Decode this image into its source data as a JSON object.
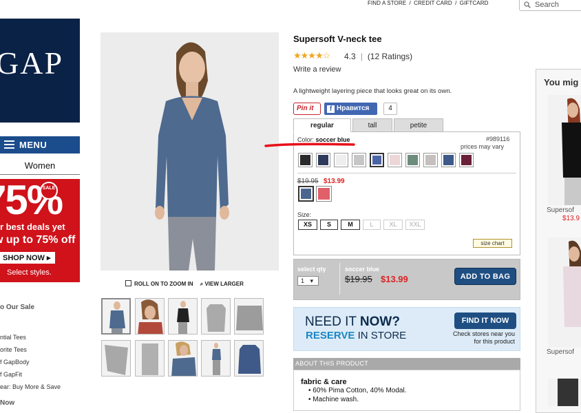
{
  "utility": {
    "find_store": "FIND A STORE",
    "credit_card": "CREDIT CARD",
    "giftcard": "GIFTCARD",
    "sep": "/",
    "search_placeholder": "Search"
  },
  "sidebar": {
    "logo": "GAP",
    "menu_label": "MENU",
    "department": "Women",
    "promo": {
      "big": "75%",
      "sale_badge": "SALE",
      "line1": "ur best deals yet",
      "line2": "w up to 75% off",
      "cta": "SHOP NOW ▸",
      "note": "Select styles."
    },
    "links": [
      "o Our Sale",
      "ntial Tees",
      "orite Tees",
      "f GapBody",
      "f GapFit",
      "ear: Buy More & Save",
      "Now"
    ]
  },
  "gallery": {
    "zoom_label": "ROLL ON TO ZOOM IN",
    "larger_label": "VIEW LARGER"
  },
  "product": {
    "title": "Supersoft V-neck tee",
    "stars": "★★★★☆",
    "rating": "4.3",
    "rating_count": "(12 Ratings)",
    "write_review": "Write a review",
    "description": "A lightweight layering piece that looks great on its own.",
    "pinit": "Pin it",
    "fb_label": "Нравится",
    "fb_count": "4",
    "tabs": [
      "regular",
      "tall",
      "petite"
    ],
    "color_prefix": "Color:",
    "color_name": "soccer blue",
    "sku": "#989116",
    "prices_vary": "prices may vary",
    "swatch_colors": [
      "#2a2a2c",
      "#2d3a5c",
      "#eeeeee",
      "#c6c6c6",
      "#4b64a6",
      "#ecd6d6",
      "#6e8c7c",
      "#c4c0c0",
      "#3e5a8a",
      "#6a2038"
    ],
    "price_old": "$19.95",
    "price_new": "$13.99",
    "sale_swatches": [
      "#4a6690",
      "#e0606a"
    ],
    "size_label": "Size:",
    "sizes": [
      {
        "label": "XS",
        "available": true
      },
      {
        "label": "S",
        "available": true
      },
      {
        "label": "M",
        "available": true
      },
      {
        "label": "L",
        "available": false
      },
      {
        "label": "XL",
        "available": false
      },
      {
        "label": "XXL",
        "available": false
      }
    ],
    "size_chart": "size chart"
  },
  "bag": {
    "qty_label": "select qty",
    "qty_value": "1",
    "item_name": "soccer blue",
    "price_old": "$19.95",
    "price_new": "$13.99",
    "add_button": "ADD TO BAG"
  },
  "store_promo": {
    "need": "NEED IT",
    "now": "NOW?",
    "reserve": "RESERVE",
    "in_store": "IN STORE",
    "find_button": "FIND IT NOW",
    "check_line1": "Check stores near you",
    "check_line2": "for this product"
  },
  "about": {
    "header": "ABOUT THIS PRODUCT",
    "fabric_heading": "fabric & care",
    "fabric_items": [
      "60% Pima Cotton, 40% Modal.",
      "Machine wash."
    ]
  },
  "rail": {
    "title": "You mig",
    "items": [
      {
        "name": "Supersof",
        "price": "$13.9"
      },
      {
        "name": "Supersof",
        "price": ""
      }
    ]
  },
  "colors": {
    "brand_navy": "#0b2247",
    "button_blue": "#1f4f82",
    "sale_red": "#d22222",
    "annotation_red": "#e8101a"
  }
}
